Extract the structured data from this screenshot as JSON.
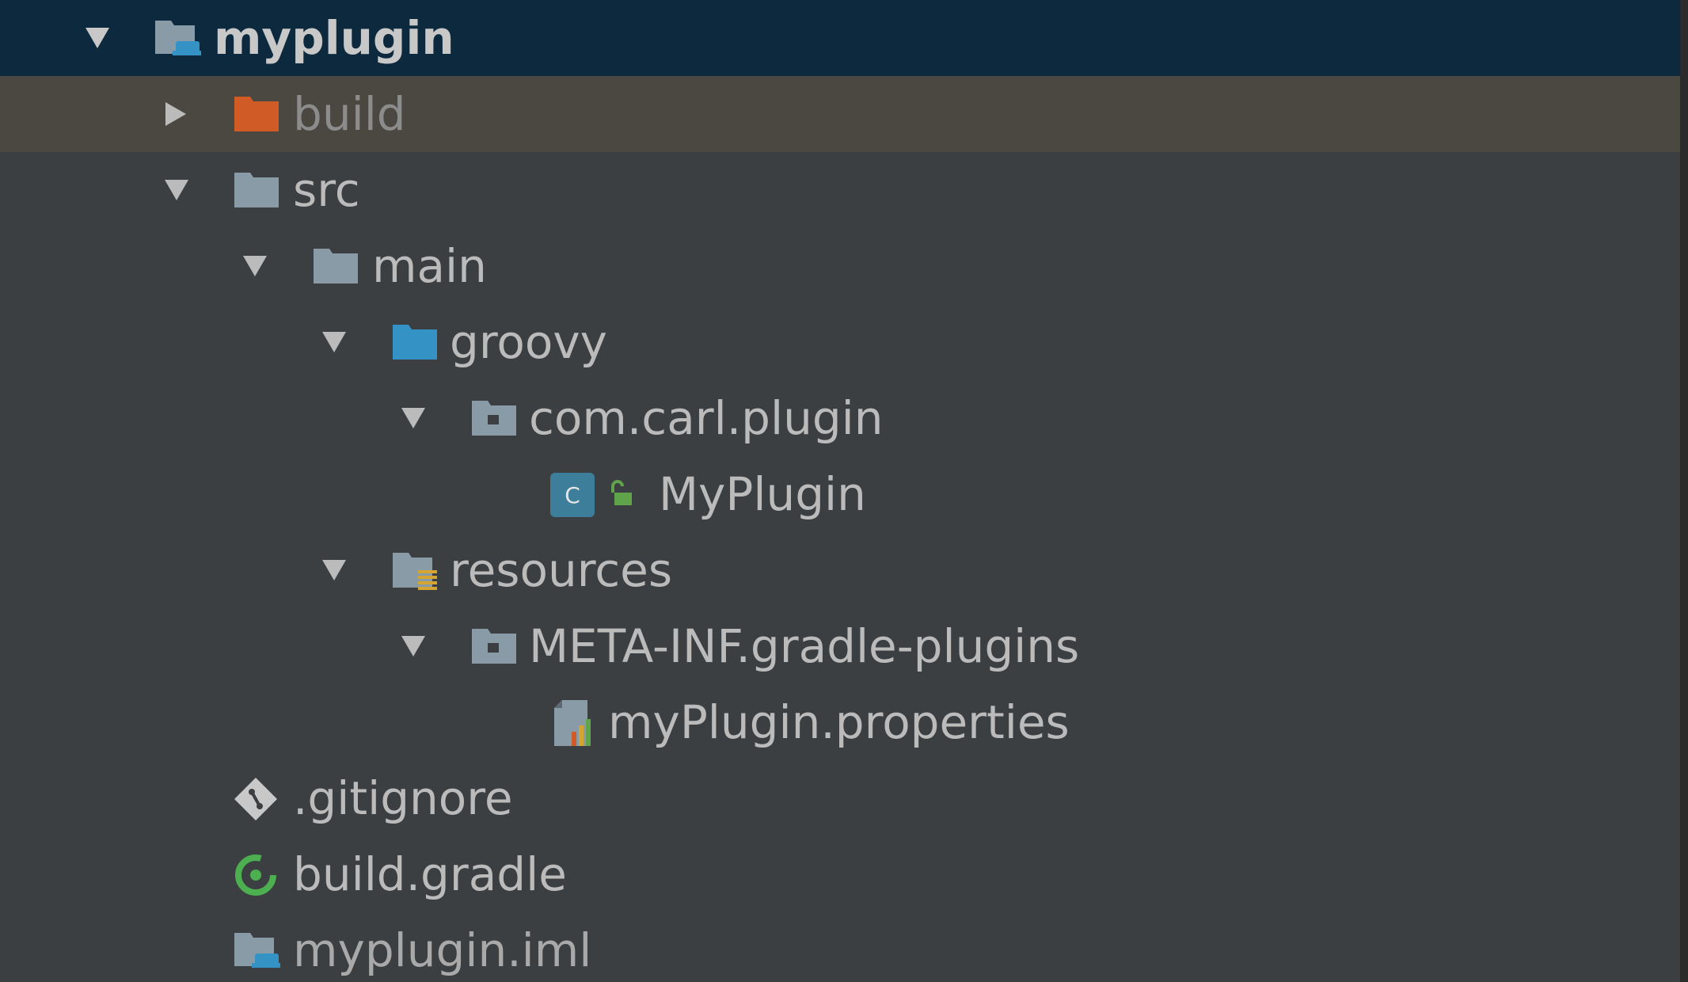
{
  "tree": {
    "root": {
      "label": "myplugin",
      "expanded": true,
      "icon": "module-folder-icon"
    },
    "build": {
      "label": "build",
      "expanded": false,
      "icon": "excluded-folder-icon"
    },
    "src": {
      "label": "src",
      "expanded": true,
      "icon": "folder-icon"
    },
    "main": {
      "label": "main",
      "expanded": true,
      "icon": "folder-icon"
    },
    "groovy": {
      "label": "groovy",
      "expanded": true,
      "icon": "source-root-folder-icon"
    },
    "package": {
      "label": "com.carl.plugin",
      "expanded": true,
      "icon": "package-icon"
    },
    "class_file": {
      "label": "MyPlugin",
      "icon": "groovy-class-icon",
      "badge": "C"
    },
    "resources": {
      "label": "resources",
      "expanded": true,
      "icon": "resources-folder-icon"
    },
    "meta_inf": {
      "label": "META-INF.gradle-plugins",
      "expanded": true,
      "icon": "package-icon"
    },
    "properties_file": {
      "label": "myPlugin.properties",
      "icon": "properties-file-icon"
    },
    "gitignore": {
      "label": ".gitignore",
      "icon": "git-icon"
    },
    "build_gradle": {
      "label": "build.gradle",
      "icon": "gradle-icon"
    },
    "iml_file": {
      "label": "myplugin.iml",
      "icon": "module-file-icon"
    }
  },
  "colors": {
    "background": "#3c3f41",
    "selected_row": "#0d293e",
    "highlight_row": "#4b4841",
    "text": "#bbbbbb",
    "folder": "#8a9ba8",
    "excluded_folder": "#d05b27",
    "source_folder": "#3592c4",
    "gradle_green": "#4caf50"
  }
}
